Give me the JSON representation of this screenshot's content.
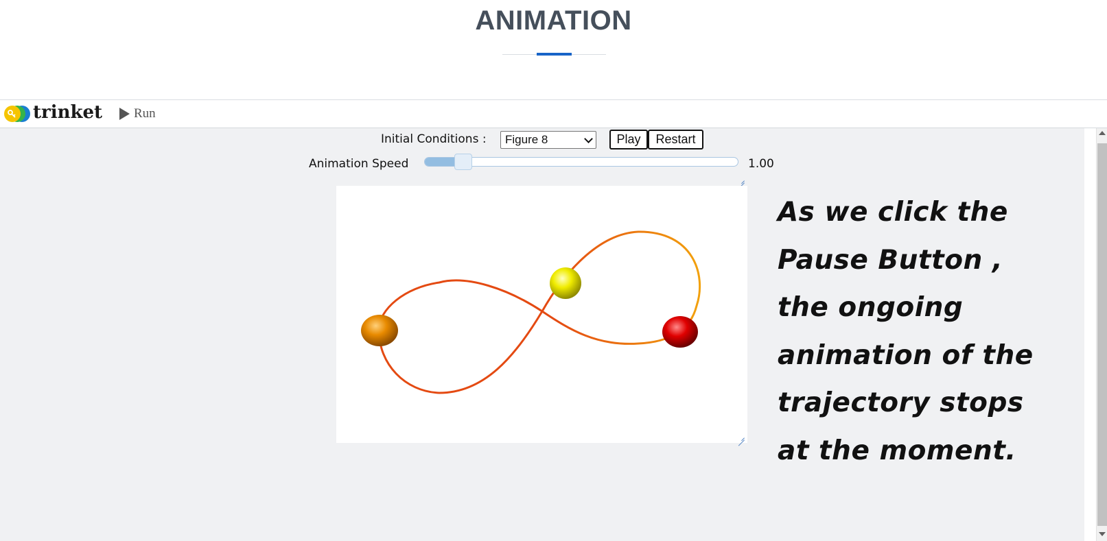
{
  "page": {
    "title": "ANIMATION"
  },
  "toolbar": {
    "logo_text": "trinket",
    "run_label": "Run"
  },
  "controls": {
    "initial_conditions_label": "Initial Conditions :",
    "initial_conditions_value": "Figure 8",
    "play_label": "Play",
    "restart_label": "Restart",
    "speed_label": "Animation Speed",
    "speed_value": "1.00",
    "speed_fraction": 0.1
  },
  "scene": {
    "trajectory_color_a": "#f2a10d",
    "trajectory_color_b": "#e44a12",
    "bodies": [
      {
        "name": "orange-body",
        "color": "#e88a00"
      },
      {
        "name": "yellow-body",
        "color": "#f0ec00"
      },
      {
        "name": "red-body",
        "color": "#e00000"
      }
    ]
  },
  "annotation": {
    "lines": [
      "As we click the",
      "Pause Button ,",
      "the ongoing",
      "animation of the",
      "trajectory stops",
      "at the moment."
    ]
  }
}
